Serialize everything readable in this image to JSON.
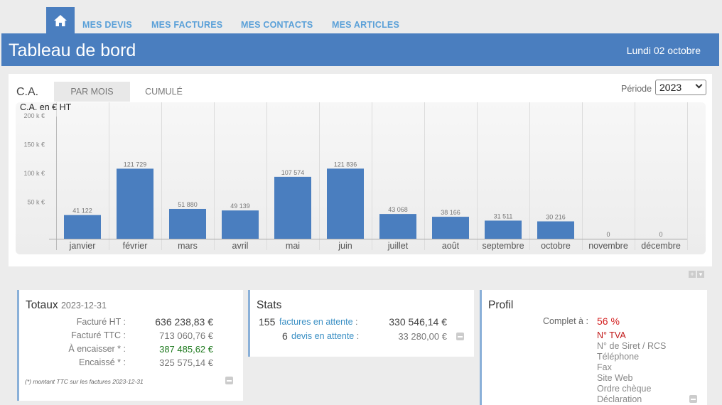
{
  "nav": {
    "home_icon": "home-icon",
    "links": [
      "MES DEVIS",
      "MES FACTURES",
      "MES CONTACTS",
      "MES ARTICLES"
    ]
  },
  "header": {
    "title": "Tableau de bord",
    "date": "Lundi 02 octobre"
  },
  "chart_panel": {
    "title": "C.A.",
    "tabs": [
      "PAR MOIS",
      "CUMULÉ"
    ],
    "active_tab": "PAR MOIS",
    "periode_label": "Période",
    "year": "2023"
  },
  "chart_data": {
    "type": "bar",
    "ylabel": "C.A. en € HT",
    "ytick_labels": [
      "50 k €",
      "100 k €",
      "150 k €",
      "200 k €"
    ],
    "ytick_values": [
      50000,
      100000,
      150000,
      200000
    ],
    "ylim": [
      0,
      200000
    ],
    "categories": [
      "janvier",
      "février",
      "mars",
      "avril",
      "mai",
      "juin",
      "juillet",
      "août",
      "septembre",
      "octobre",
      "novembre",
      "décembre"
    ],
    "values": [
      41122,
      121729,
      51880,
      49139,
      107574,
      121836,
      43068,
      38166,
      31511,
      30216,
      0,
      0
    ],
    "value_labels": [
      "41 122",
      "121 729",
      "51 880",
      "49 139",
      "107 574",
      "121 836",
      "43 068",
      "38 166",
      "31 511",
      "30 216",
      "0",
      "0"
    ],
    "bar_color": "#4a7ebf",
    "grid": "vertical"
  },
  "totaux": {
    "title": "Totaux",
    "date": "2023-12-31",
    "rows": [
      {
        "label": "Facturé HT :",
        "value": "636 238,83 €",
        "color": "#444444"
      },
      {
        "label": "Facturé TTC :",
        "value": "713 060,76 €",
        "color": "#777777"
      },
      {
        "label": "À encaisser * :",
        "value": "387 485,62 €",
        "color": "#1e7a1e"
      },
      {
        "label": "Encaissé * :",
        "value": "325 575,14 €",
        "color": "#777777"
      }
    ],
    "note": "(*) montant TTC sur les factures 2023-12-31"
  },
  "stats": {
    "title": "Stats",
    "rows": [
      {
        "count": "155",
        "link": "factures en attente",
        "value": "330 546,14 €"
      },
      {
        "count": "6",
        "link": "devis en attente",
        "value": "33 280,00 €"
      }
    ],
    "colon": ":"
  },
  "profil": {
    "title": "Profil",
    "complete_label": "Complet à :",
    "complete_pct": "56 %",
    "missing": [
      {
        "label": "N° TVA",
        "highlight": true
      },
      {
        "label": "N° de Siret / RCS",
        "highlight": false
      },
      {
        "label": "Téléphone",
        "highlight": false
      },
      {
        "label": "Fax",
        "highlight": false
      },
      {
        "label": "Site Web",
        "highlight": false
      },
      {
        "label": "Ordre chèque",
        "highlight": false
      },
      {
        "label": "Déclaration",
        "highlight": false
      }
    ]
  },
  "colors": {
    "primary": "#4a7ebf",
    "nav_link": "#5aa0d8",
    "link": "#3a8fc4",
    "alert": "#d42020",
    "positive": "#1e7a1e"
  }
}
